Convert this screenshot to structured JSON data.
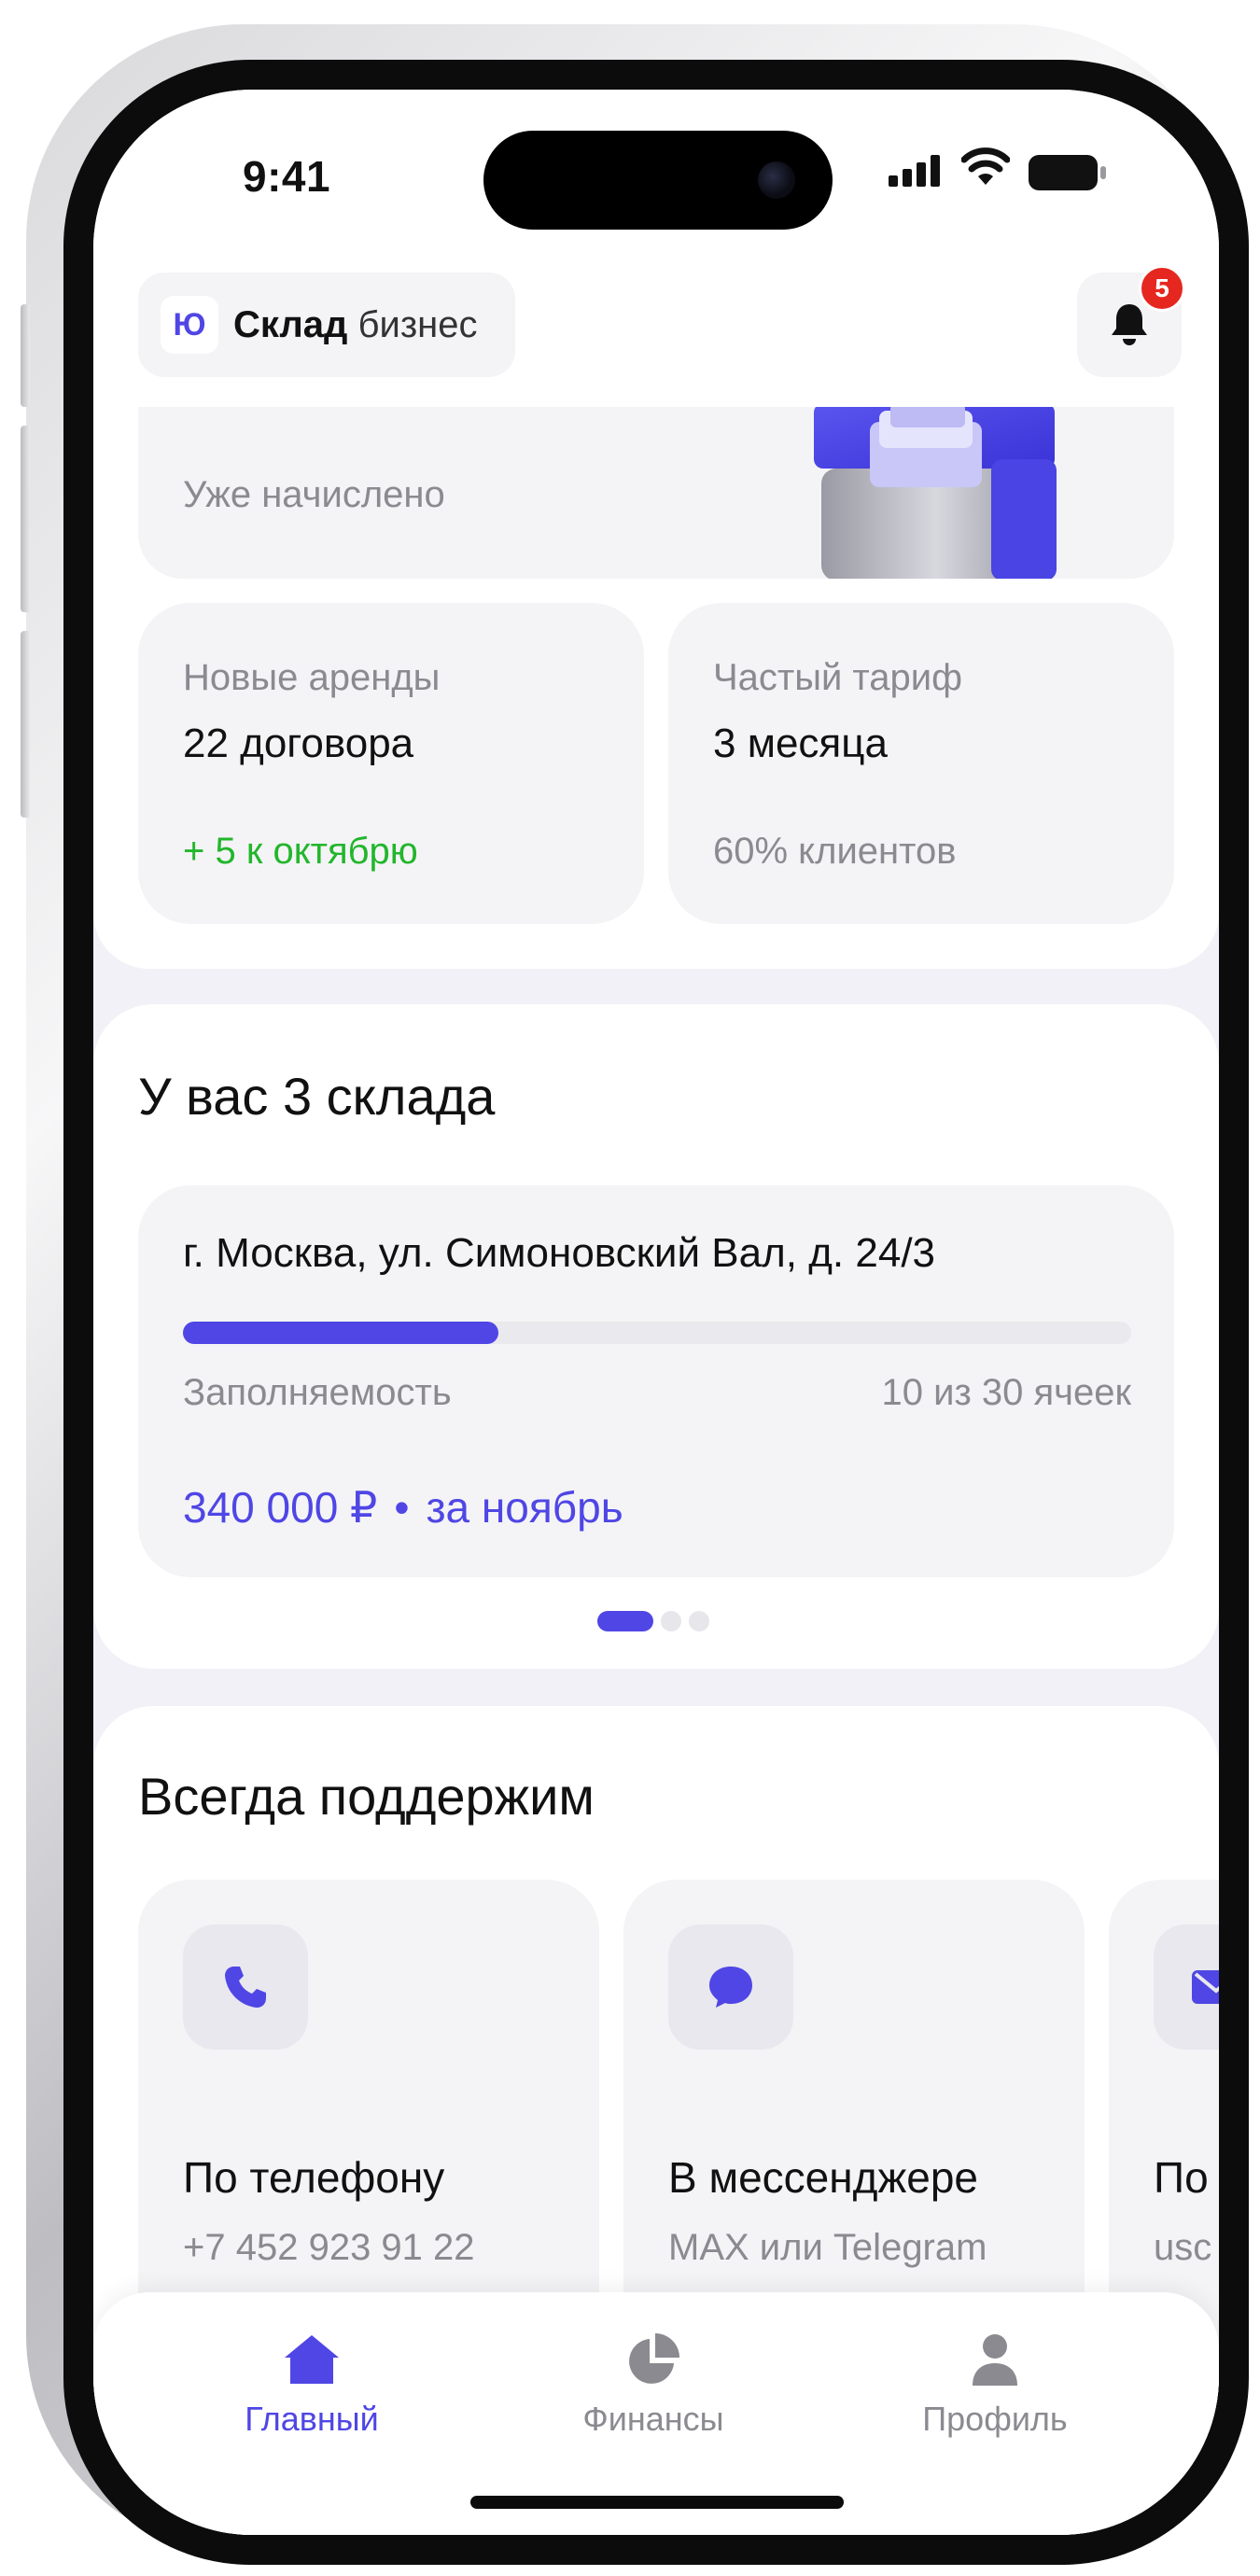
{
  "status_bar": {
    "time": "9:41"
  },
  "header": {
    "logo_letter": "Ю",
    "brand_bold": "Склад",
    "brand_light": "бизнес",
    "notifications_count": "5"
  },
  "accrued": {
    "label": "Уже начислено"
  },
  "stats": [
    {
      "title": "Новые аренды",
      "value": "22 договора",
      "note": "+ 5 к октябрю"
    },
    {
      "title": "Частый тариф",
      "value": "3 месяца",
      "note": "60% клиентов"
    }
  ],
  "warehouses": {
    "title": "У вас 3 склада",
    "card": {
      "address": "г. Москва, ул. Симоновский Вал, д. 24/3",
      "occupancy_label": "Заполняемость",
      "occupancy_text": "10 из 30 ячеек",
      "occupancy_fraction": 0.333,
      "income": "340 000 ₽",
      "separator": "•",
      "period": "за ноябрь"
    },
    "pages": 3,
    "active_page": 1
  },
  "support": {
    "title": "Всегда поддержим",
    "cards": [
      {
        "icon": "phone-icon",
        "title": "По телефону",
        "value": "+7 452 923 91 22"
      },
      {
        "icon": "chat-bubble-icon",
        "title": "В мессенджере",
        "value": "MAX или Telegram"
      },
      {
        "icon": "mail-icon",
        "title": "По",
        "value": "usc"
      }
    ]
  },
  "tabbar": {
    "items": [
      {
        "label": "Главный",
        "icon": "home-icon",
        "active": true
      },
      {
        "label": "Финансы",
        "icon": "pie-chart-icon",
        "active": false
      },
      {
        "label": "Профиль",
        "icon": "user-icon",
        "active": false
      }
    ]
  },
  "colors": {
    "accent": "#4f46e5",
    "positive": "#22b62c",
    "badge": "#e5271f",
    "muted": "#8a8a90"
  }
}
